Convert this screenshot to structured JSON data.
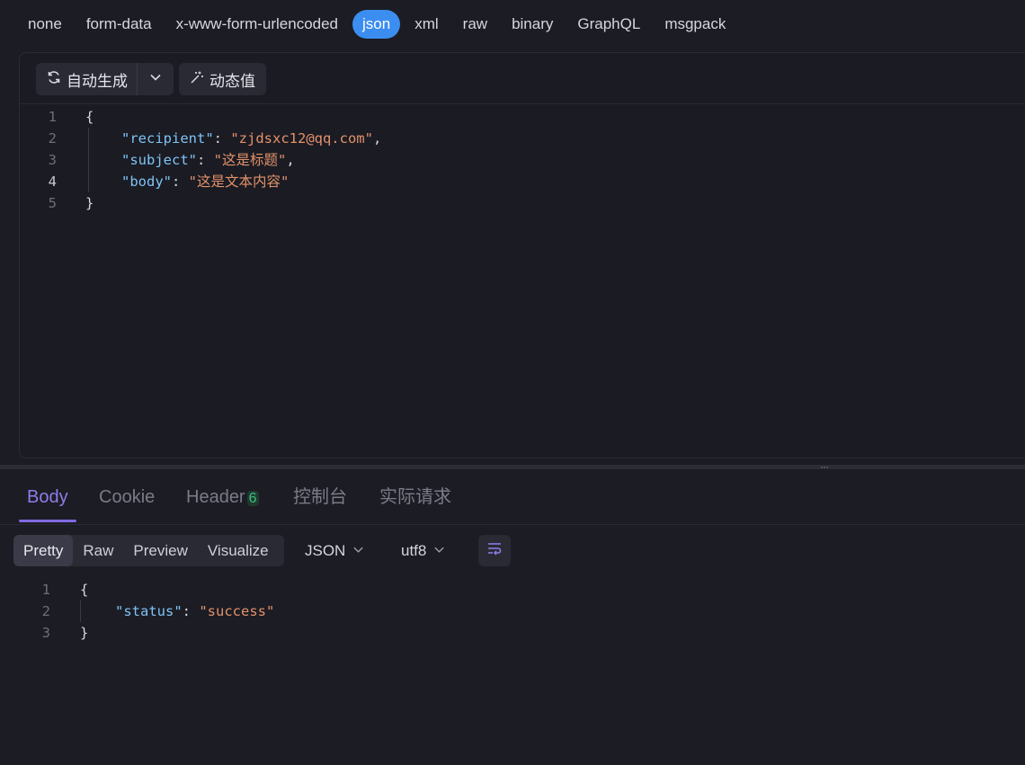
{
  "body_types": {
    "items": [
      "none",
      "form-data",
      "x-www-form-urlencoded",
      "json",
      "xml",
      "raw",
      "binary",
      "GraphQL",
      "msgpack"
    ],
    "active": "json"
  },
  "editor_toolbar": {
    "auto_generate_label": "自动生成",
    "dynamic_value_label": "动态值",
    "icons": [
      "refresh-icon",
      "chevron-down-icon",
      "magic-wand-icon"
    ]
  },
  "request_body": {
    "lines": [
      {
        "n": "1",
        "segments": [
          {
            "t": "{",
            "c": "p"
          }
        ]
      },
      {
        "n": "2",
        "segments": [
          {
            "t": "\"recipient\"",
            "c": "k"
          },
          {
            "t": ": ",
            "c": "p"
          },
          {
            "t": "\"zjdsxc12@qq.com\"",
            "c": "s"
          },
          {
            "t": ",",
            "c": "p"
          }
        ]
      },
      {
        "n": "3",
        "segments": [
          {
            "t": "\"subject\"",
            "c": "k"
          },
          {
            "t": ": ",
            "c": "p"
          },
          {
            "t": "\"这是标题\"",
            "c": "s"
          },
          {
            "t": ",",
            "c": "p"
          }
        ]
      },
      {
        "n": "4",
        "segments": [
          {
            "t": "\"body\"",
            "c": "k"
          },
          {
            "t": ": ",
            "c": "p"
          },
          {
            "t": "\"这是文本内容\"",
            "c": "s"
          }
        ]
      },
      {
        "n": "5",
        "segments": [
          {
            "t": "}",
            "c": "p"
          }
        ]
      }
    ],
    "current_line": "4"
  },
  "response_tabs": {
    "body": "Body",
    "cookie": "Cookie",
    "header": "Header",
    "header_count": "6",
    "console": "控制台",
    "actual_request": "实际请求",
    "active": "Body"
  },
  "response_toolbar": {
    "views": [
      "Pretty",
      "Raw",
      "Preview",
      "Visualize"
    ],
    "active_view": "Pretty",
    "format": "JSON",
    "encoding": "utf8"
  },
  "response_body": {
    "lines": [
      {
        "n": "1",
        "segments": [
          {
            "t": "{",
            "c": "p"
          }
        ]
      },
      {
        "n": "2",
        "segments": [
          {
            "t": "\"status\"",
            "c": "k"
          },
          {
            "t": ": ",
            "c": "p"
          },
          {
            "t": "\"success\"",
            "c": "s"
          }
        ]
      },
      {
        "n": "3",
        "segments": [
          {
            "t": "}",
            "c": "p"
          }
        ]
      }
    ]
  }
}
